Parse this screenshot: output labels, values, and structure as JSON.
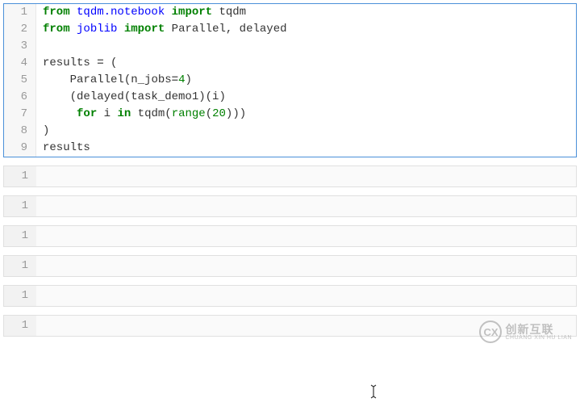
{
  "code": {
    "lines": [
      {
        "num": "1",
        "indent": ""
      },
      {
        "num": "2",
        "indent": ""
      },
      {
        "num": "3",
        "indent": ""
      },
      {
        "num": "4",
        "indent": ""
      },
      {
        "num": "5",
        "indent": "    "
      },
      {
        "num": "6",
        "indent": "    "
      },
      {
        "num": "7",
        "indent": "     "
      },
      {
        "num": "8",
        "indent": ""
      },
      {
        "num": "9",
        "indent": ""
      }
    ],
    "tokens": {
      "from": "from",
      "import": "import",
      "for": "for",
      "in": "in",
      "tqdm_notebook": "tqdm.notebook",
      "tqdm": "tqdm",
      "joblib": "joblib",
      "Parallel_delayed": "Parallel, delayed",
      "results": "results",
      "equals": "=",
      "open_paren": "(",
      "close_paren": ")",
      "Parallel": "Parallel",
      "n_jobs": "n_jobs",
      "four": "4",
      "delayed_call": "(delayed(task_demo1)(i)",
      "i": "i",
      "range": "range",
      "twenty": "20",
      "triple_close": ")))"
    }
  },
  "outputs": [
    {
      "num": "1"
    },
    {
      "num": "1"
    },
    {
      "num": "1"
    },
    {
      "num": "1"
    },
    {
      "num": "1"
    },
    {
      "num": "1"
    }
  ],
  "watermark": {
    "logo": "CX",
    "main": "创新互联",
    "sub": "CHUANG XIN HU LIAN"
  }
}
